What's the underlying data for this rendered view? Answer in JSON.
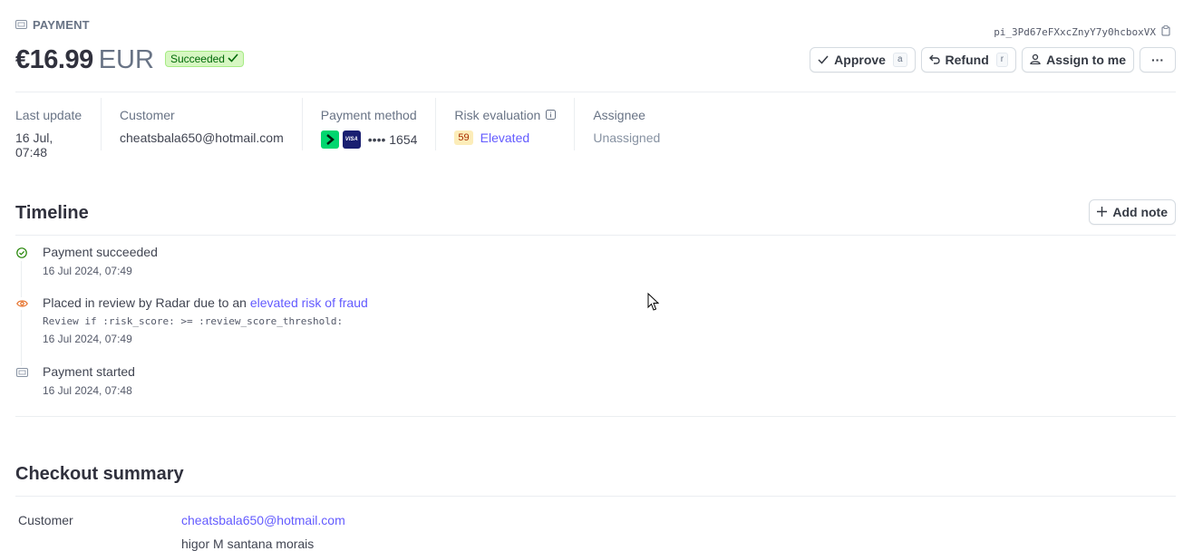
{
  "header": {
    "eyebrow": "PAYMENT",
    "payment_id": "pi_3Pd67eFXxcZnyY7y0hcboxVX",
    "amount": "€16.99",
    "currency": "EUR",
    "status": "Succeeded",
    "actions": {
      "approve_label": "Approve",
      "approve_key": "a",
      "refund_label": "Refund",
      "refund_key": "r",
      "assign_label": "Assign to me",
      "more_label": "···"
    }
  },
  "summary": {
    "last_update_label": "Last update",
    "last_update_value": "16 Jul, 07:48",
    "customer_label": "Customer",
    "customer_value": "cheatsbala650@hotmail.com",
    "payment_method_label": "Payment method",
    "card_brand_text": "VISA",
    "card_last4": "•••• 1654",
    "risk_label": "Risk evaluation",
    "risk_score": "59",
    "risk_level": "Elevated",
    "assignee_label": "Assignee",
    "assignee_value": "Unassigned"
  },
  "timeline": {
    "title": "Timeline",
    "add_note_label": "Add note",
    "events": [
      {
        "title": "Payment succeeded",
        "time": "16 Jul 2024, 07:49"
      },
      {
        "title_prefix": "Placed in review by Radar due to an ",
        "title_link": "elevated risk of fraud",
        "code": "Review if :risk_score: >= :review_score_threshold:",
        "time": "16 Jul 2024, 07:49"
      },
      {
        "title": "Payment started",
        "time": "16 Jul 2024, 07:48"
      }
    ]
  },
  "checkout": {
    "title": "Checkout summary",
    "customer_label": "Customer",
    "customer_email": "cheatsbala650@hotmail.com",
    "customer_name": "higor M santana morais"
  },
  "colors": {
    "accent": "#635bff",
    "success": "#006908",
    "warning": "#e56f27"
  }
}
